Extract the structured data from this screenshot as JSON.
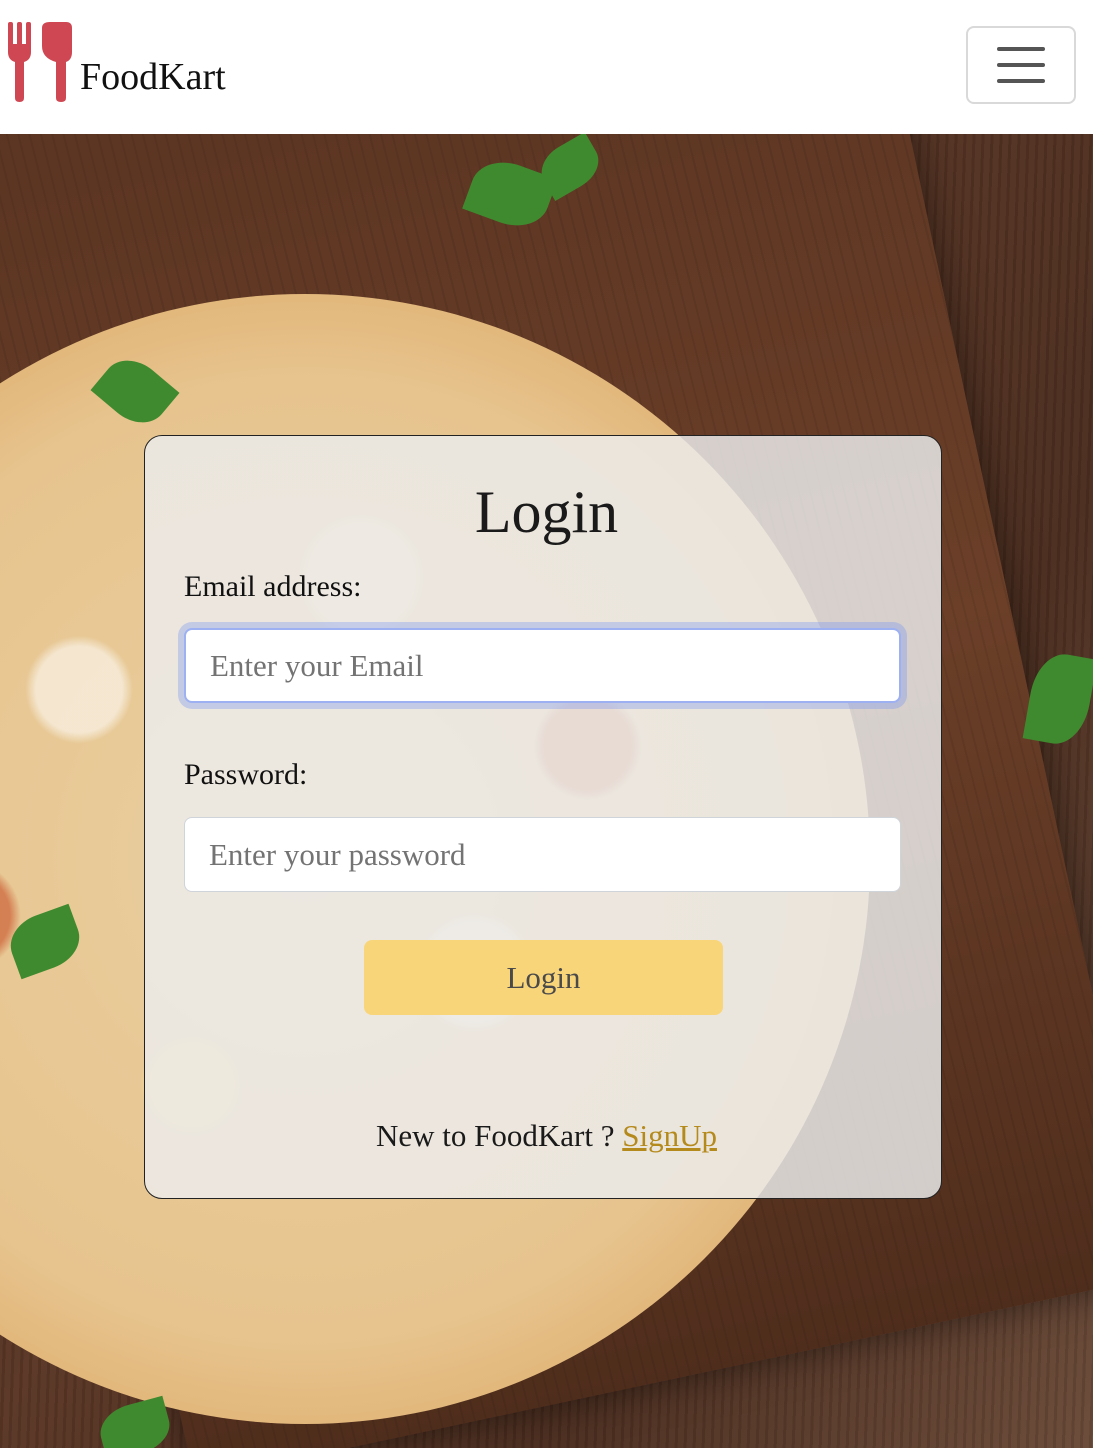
{
  "brand": {
    "name": "FoodKart",
    "logo_icon": "fork-knife-icon",
    "logo_color": "#cf4752"
  },
  "navbar": {
    "toggler_icon": "hamburger-icon"
  },
  "login": {
    "title": "Login",
    "email_label": "Email address:",
    "email_placeholder": "Enter your Email",
    "password_label": "Password:",
    "password_placeholder": "Enter your password",
    "submit_label": "Login",
    "signup_prompt": "New to FoodKart ?",
    "signup_link": "SignUp"
  },
  "colors": {
    "button_bg": "#f9d57a",
    "link": "#b58a1c",
    "focus_ring": "#9db0f2"
  }
}
